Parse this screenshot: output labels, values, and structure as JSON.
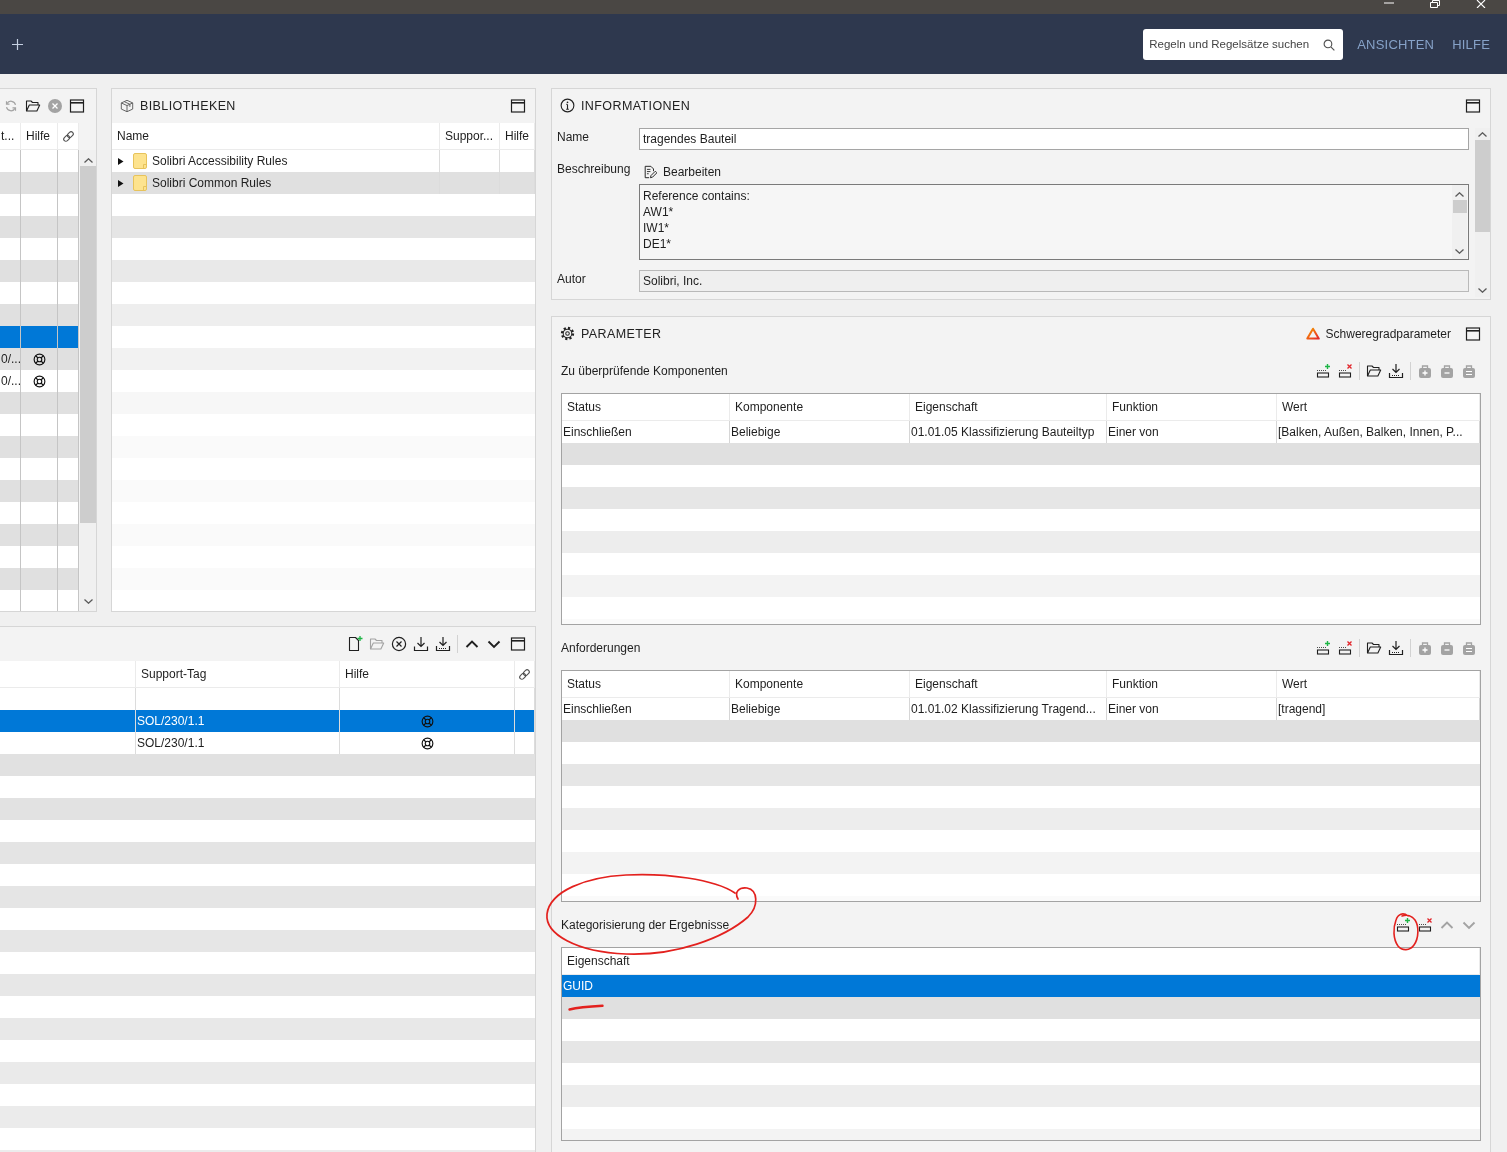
{
  "header": {
    "search": {
      "placeholder": "Regeln und Regelsätze suchen"
    },
    "menu": [
      {
        "label": "ANSICHTEN"
      },
      {
        "label": "HILFE"
      }
    ]
  },
  "rules_panel": {
    "tools": [
      {
        "kind": "refresh",
        "disabled": true
      },
      {
        "kind": "open",
        "disabled": false
      },
      {
        "kind": "cancel",
        "disabled": true
      }
    ],
    "columns": [
      "t...",
      "Hilfe"
    ],
    "rows": [
      {
        "selected": false,
        "help": false
      },
      {
        "selected": false,
        "help": false
      },
      {
        "selected": false,
        "help": false
      },
      {
        "selected": false,
        "help": false
      },
      {
        "selected": false,
        "help": false
      },
      {
        "selected": false,
        "help": false
      },
      {
        "selected": false,
        "help": false
      },
      {
        "selected": false,
        "help": false
      },
      {
        "selected": true,
        "help": false
      },
      {
        "tag": "0/...",
        "help": true,
        "selected": false
      },
      {
        "tag": "0/...",
        "help": true,
        "selected": false
      }
    ]
  },
  "libraries": {
    "title": "BIBLIOTHEKEN",
    "columns": [
      "Name",
      "Suppor...",
      "Hilfe"
    ],
    "rows": [
      {
        "name": "Solibri Accessibility Rules",
        "expanded": false,
        "selected": false
      },
      {
        "name": "Solibri Common Rules",
        "expanded": false,
        "selected": false
      }
    ]
  },
  "rule_list": {
    "tool_groups": [
      {
        "tools": [
          {
            "kind": "new-rule",
            "disabled": false
          },
          {
            "kind": "open",
            "disabled": true
          },
          {
            "kind": "close-circle",
            "disabled": false
          },
          {
            "kind": "export",
            "disabled": false
          },
          {
            "kind": "import",
            "disabled": false
          }
        ]
      },
      {
        "tools": [
          {
            "kind": "up",
            "disabled": false
          },
          {
            "kind": "down",
            "disabled": false
          }
        ]
      }
    ],
    "columns": [
      "Support-Tag",
      "Hilfe"
    ],
    "rows": [
      {
        "selected": false,
        "help": false
      },
      {
        "tag": "SOL/230/1.1",
        "help": true,
        "selected": true
      },
      {
        "tag": "SOL/230/1.1",
        "help": true,
        "selected": false
      }
    ]
  },
  "information": {
    "title": "INFORMATIONEN",
    "fields": [
      {
        "kind": "text",
        "label": "Name",
        "value": "tragendes Bauteil"
      },
      {
        "kind": "description",
        "label": "Beschreibung",
        "button": "Bearbeiten",
        "lines": [
          "Reference contains:",
          "AW1*",
          "IW1*",
          "DE1*"
        ]
      },
      {
        "kind": "readonly",
        "label": "Autor",
        "value": "Solibri, Inc."
      }
    ]
  },
  "parameters": {
    "title": "PARAMETER",
    "severity_button": "Schweregradparameter",
    "sections": [
      {
        "title": "Zu überprüfende Komponenten",
        "tool_groups": [
          {
            "tools": [
              {
                "kind": "add-row",
                "disabled": false
              },
              {
                "kind": "remove-row",
                "disabled": false
              }
            ]
          },
          {
            "tools": [
              {
                "kind": "open",
                "disabled": false
              },
              {
                "kind": "import",
                "disabled": false
              }
            ]
          },
          {
            "tools": [
              {
                "kind": "bag-add",
                "disabled": true
              },
              {
                "kind": "bag-remove",
                "disabled": true
              },
              {
                "kind": "bag-list",
                "disabled": true
              }
            ]
          }
        ],
        "columns": [
          "Status",
          "Komponente",
          "Eigenschaft",
          "Funktion",
          "Wert"
        ],
        "rows": [
          {
            "cells": [
              "Einschließen",
              "Beliebige",
              "01.01.05 Klassifizierung Bauteiltyp",
              "Einer von",
              "[Balken, Außen, Balken, Innen, P..."
            ],
            "selected": false
          }
        ]
      },
      {
        "title": "Anforderungen",
        "tool_groups": [
          {
            "tools": [
              {
                "kind": "add-row",
                "disabled": false
              },
              {
                "kind": "remove-row",
                "disabled": false
              }
            ]
          },
          {
            "tools": [
              {
                "kind": "open",
                "disabled": false
              },
              {
                "kind": "import",
                "disabled": false
              }
            ]
          },
          {
            "tools": [
              {
                "kind": "bag-add",
                "disabled": true
              },
              {
                "kind": "bag-remove",
                "disabled": true
              },
              {
                "kind": "bag-list",
                "disabled": true
              }
            ]
          }
        ],
        "columns": [
          "Status",
          "Komponente",
          "Eigenschaft",
          "Funktion",
          "Wert"
        ],
        "rows": [
          {
            "cells": [
              "Einschließen",
              "Beliebige",
              "01.01.02 Klassifizierung Tragend...",
              "Einer von",
              "[tragend]"
            ],
            "selected": false
          }
        ]
      },
      {
        "title": "Kategorisierung der Ergebnisse",
        "tool_groups": [
          {
            "tools": [
              {
                "kind": "add-row",
                "disabled": false
              },
              {
                "kind": "remove-row",
                "disabled": false
              },
              {
                "kind": "up",
                "disabled": true
              },
              {
                "kind": "down",
                "disabled": true
              }
            ]
          }
        ],
        "columns": [
          "Eigenschaft"
        ],
        "rows": [
          {
            "cells": [
              "GUID"
            ],
            "selected": true
          }
        ],
        "annotations": [
          {
            "kind": "ellipse"
          },
          {
            "kind": "circle"
          },
          {
            "kind": "underline"
          }
        ]
      }
    ]
  }
}
